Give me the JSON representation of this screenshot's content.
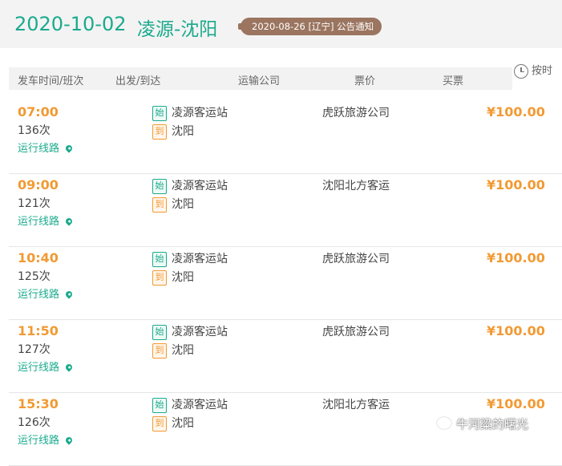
{
  "header": {
    "date": "2020-10-02",
    "route": "凌源-沈阳",
    "notice": "2020-08-26 [辽宁] 公告通知"
  },
  "columns": {
    "time": "发车时间/班次",
    "stations": "出发/到达",
    "company": "运输公司",
    "price": "票价",
    "buy": "买票"
  },
  "sort_label": "按时",
  "labels": {
    "start_tag": "始",
    "end_tag": "到",
    "route_link": "运行线路"
  },
  "trips": [
    {
      "time": "07:00",
      "trip_no": "136次",
      "from": "凌源客运站",
      "to": "沈阳",
      "company": "虎跃旅游公司",
      "price": "¥100.00"
    },
    {
      "time": "09:00",
      "trip_no": "121次",
      "from": "凌源客运站",
      "to": "沈阳",
      "company": "沈阳北方客运",
      "price": "¥100.00"
    },
    {
      "time": "10:40",
      "trip_no": "125次",
      "from": "凌源客运站",
      "to": "沈阳",
      "company": "虎跃旅游公司",
      "price": "¥100.00"
    },
    {
      "time": "11:50",
      "trip_no": "127次",
      "from": "凌源客运站",
      "to": "沈阳",
      "company": "虎跃旅游公司",
      "price": "¥100.00"
    },
    {
      "time": "15:30",
      "trip_no": "126次",
      "from": "凌源客运站",
      "to": "沈阳",
      "company": "沈阳北方客运",
      "price": "¥100.00"
    }
  ],
  "watermark": "牛河粱的曙光",
  "colors": {
    "teal": "#1aaa8d",
    "orange": "#f29a33",
    "notice_bg": "#9b7560"
  }
}
